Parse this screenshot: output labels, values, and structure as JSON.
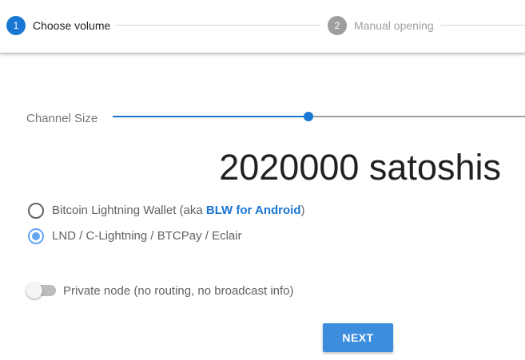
{
  "stepper": {
    "step1": {
      "number": "1",
      "label": "Choose volume",
      "active": true
    },
    "step2": {
      "number": "2",
      "label": "Manual opening",
      "active": false
    }
  },
  "channel": {
    "slider_label": "Channel Size",
    "slider_fraction": 0.475,
    "amount_value": "2020000",
    "amount_unit": "satoshis",
    "amount_text": "2020000 satoshis"
  },
  "wallet_options": [
    {
      "prefix": "Bitcoin Lightning Wallet (aka ",
      "link": "BLW for Android",
      "suffix": ")",
      "selected": false
    },
    {
      "label": "LND / C-Lightning / BTCPay / Eclair",
      "selected": true
    }
  ],
  "private_node": {
    "label": "Private node (no routing, no broadcast info)",
    "enabled": false
  },
  "next_button": "NEXT",
  "colors": {
    "accent": "#1976d2",
    "radio_selected": "#64a5f0",
    "button": "#3c8dde",
    "inactive": "#9e9e9e"
  }
}
